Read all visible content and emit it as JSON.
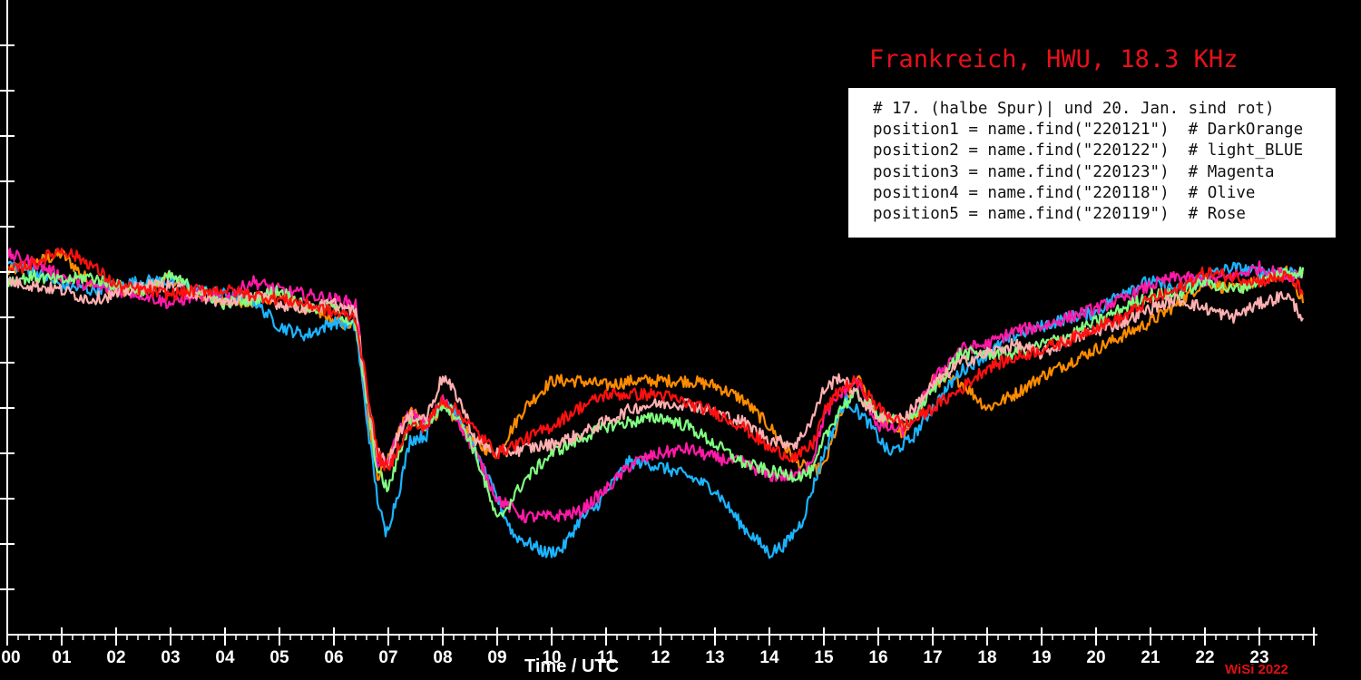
{
  "chart_data": {
    "type": "line",
    "title": "Frankreich, HWU, 18.3 KHz",
    "xlabel": "Time / UTC",
    "ylabel": "",
    "x_ticks": [
      "00",
      "01",
      "02",
      "03",
      "04",
      "05",
      "06",
      "07",
      "08",
      "09",
      "10",
      "11",
      "12",
      "13",
      "14",
      "15",
      "16",
      "17",
      "18",
      "19",
      "20",
      "21",
      "22",
      "23"
    ],
    "xlim": [
      0,
      24
    ],
    "ylim": [
      0,
      14
    ],
    "grid": false,
    "legend_text": [
      "# 17. (halbe Spur)| und 20. Jan. sind rot)",
      "position1 = name.find(\"220121\")  # DarkOrange",
      "position2 = name.find(\"220122\")  # light_BLUE",
      "position3 = name.find(\"220123\")  # Magenta",
      "position4 = name.find(\"220118\")  # Olive",
      "position5 = name.find(\"220119\")  # Rose"
    ],
    "legend_placement": "top-right",
    "series": [
      {
        "color": "#ff8c00",
        "x": [
          0,
          0.5,
          1,
          1.5,
          2,
          2.5,
          3,
          3.5,
          4,
          4.5,
          5,
          5.5,
          6,
          6.4,
          6.6,
          6.8,
          7,
          7.2,
          7.4,
          7.7,
          8,
          8.3,
          8.6,
          9,
          9.5,
          10,
          10.5,
          11,
          11.5,
          12,
          12.5,
          13,
          13.5,
          14,
          14.5,
          14.8,
          15,
          15.3,
          15.6,
          16,
          16.5,
          17,
          17.5,
          18,
          18.5,
          19,
          19.5,
          20,
          20.5,
          21,
          21.5,
          22,
          22.5,
          23,
          23.5,
          23.8
        ],
        "y": [
          8.0,
          8.2,
          8.4,
          7.8,
          7.6,
          7.6,
          7.9,
          7.5,
          7.4,
          7.3,
          7.5,
          7.2,
          6.9,
          6.8,
          5.0,
          3.5,
          3.9,
          4.5,
          4.9,
          4.7,
          5.0,
          4.7,
          4.2,
          4.0,
          5.0,
          5.6,
          5.6,
          5.5,
          5.6,
          5.6,
          5.6,
          5.5,
          5.2,
          4.6,
          3.8,
          3.6,
          3.7,
          4.8,
          5.7,
          4.8,
          4.4,
          5.6,
          5.6,
          5.0,
          5.3,
          5.7,
          6.0,
          6.3,
          6.6,
          6.9,
          7.3,
          7.8,
          7.6,
          7.8,
          8.0,
          7.4
        ]
      },
      {
        "color": "#1cb4ff",
        "x": [
          0,
          0.5,
          1,
          1.5,
          2,
          2.5,
          3,
          3.5,
          4,
          4.5,
          5,
          5.5,
          6,
          6.4,
          6.6,
          6.8,
          6.95,
          7.2,
          7.4,
          7.7,
          8,
          8.3,
          8.6,
          9,
          9.3,
          9.6,
          9.9,
          10.2,
          10.5,
          10.8,
          11.1,
          11.4,
          11.7,
          12,
          12.5,
          13,
          13.5,
          14,
          14.3,
          14.6,
          15,
          15.4,
          15.8,
          16.2,
          16.6,
          17,
          17.5,
          18,
          18.5,
          19,
          19.5,
          20,
          20.5,
          21,
          21.5,
          22,
          22.5,
          23,
          23.5,
          23.8
        ],
        "y": [
          8.2,
          8.0,
          7.7,
          7.6,
          7.7,
          7.8,
          7.8,
          7.6,
          7.5,
          7.4,
          6.8,
          6.6,
          6.9,
          6.8,
          4.8,
          3.0,
          2.2,
          3.2,
          4.3,
          4.4,
          5.3,
          4.8,
          4.0,
          3.0,
          2.2,
          2.0,
          1.8,
          1.9,
          2.5,
          2.8,
          3.3,
          3.8,
          3.8,
          3.7,
          3.5,
          3.2,
          2.4,
          1.8,
          2.0,
          2.5,
          4.0,
          5.2,
          4.7,
          4.0,
          4.3,
          5.0,
          5.8,
          6.2,
          6.6,
          6.8,
          7.0,
          7.1,
          7.6,
          7.8,
          7.6,
          7.9,
          8.1,
          8.0,
          8.0,
          8.0
        ]
      },
      {
        "color": "#ff1aa8",
        "x": [
          0,
          0.5,
          1,
          1.5,
          2,
          2.5,
          3,
          3.5,
          4,
          4.5,
          5,
          5.5,
          6,
          6.4,
          6.6,
          6.8,
          7,
          7.2,
          7.4,
          7.7,
          8,
          8.3,
          8.6,
          9,
          9.5,
          10,
          10.5,
          11,
          11.5,
          12,
          12.5,
          13,
          13.5,
          14,
          14.5,
          14.8,
          15,
          15.3,
          15.6,
          16,
          16.5,
          17,
          17.5,
          18,
          18.5,
          19,
          19.5,
          20,
          20.5,
          21,
          21.5,
          22,
          22.5,
          23,
          23.5,
          23.8
        ],
        "y": [
          8.4,
          8.2,
          7.9,
          7.7,
          7.6,
          7.5,
          7.3,
          7.5,
          7.4,
          7.8,
          7.6,
          7.5,
          7.4,
          7.3,
          5.2,
          3.8,
          3.8,
          4.5,
          4.9,
          4.6,
          5.2,
          4.7,
          4.0,
          3.0,
          2.6,
          2.6,
          2.7,
          3.2,
          3.8,
          4.0,
          4.1,
          3.9,
          3.8,
          3.5,
          3.5,
          3.9,
          4.8,
          5.3,
          5.6,
          4.6,
          4.5,
          5.6,
          6.3,
          6.4,
          6.7,
          6.8,
          7.0,
          7.2,
          7.4,
          7.7,
          7.9,
          7.8,
          7.9,
          8.1,
          7.9,
          8.0
        ]
      },
      {
        "color": "#80ff80",
        "x": [
          0,
          0.5,
          1,
          1.5,
          2,
          2.5,
          3,
          3.5,
          4,
          4.5,
          5,
          5.5,
          6,
          6.4,
          6.6,
          6.8,
          7,
          7.2,
          7.4,
          7.7,
          8,
          8.3,
          8.6,
          9,
          9.5,
          10,
          10.5,
          11,
          11.5,
          12,
          12.5,
          13,
          13.5,
          14,
          14.5,
          14.8,
          15,
          15.3,
          15.6,
          16,
          16.5,
          17,
          17.5,
          18,
          18.5,
          19,
          19.5,
          20,
          20.5,
          21,
          21.5,
          22,
          22.5,
          23,
          23.5,
          23.8
        ],
        "y": [
          7.8,
          7.9,
          7.8,
          7.9,
          7.7,
          7.6,
          7.9,
          7.6,
          7.3,
          7.4,
          7.6,
          7.2,
          7.2,
          6.8,
          5.2,
          3.6,
          3.2,
          4.0,
          4.7,
          4.6,
          5.1,
          4.8,
          4.0,
          2.5,
          3.4,
          4.0,
          4.3,
          4.6,
          4.7,
          4.8,
          4.6,
          4.2,
          3.8,
          3.6,
          3.5,
          3.6,
          4.3,
          5.0,
          5.3,
          4.9,
          4.6,
          5.4,
          6.2,
          6.2,
          6.2,
          6.4,
          6.6,
          6.9,
          7.2,
          7.5,
          7.5,
          7.8,
          7.6,
          7.8,
          8.0,
          8.0
        ]
      },
      {
        "color": "#ffb0b0",
        "x": [
          0,
          0.5,
          1,
          1.5,
          2,
          2.5,
          3,
          3.5,
          4,
          4.5,
          5,
          5.5,
          6,
          6.4,
          6.6,
          6.8,
          7,
          7.2,
          7.4,
          7.7,
          8,
          8.3,
          8.6,
          9,
          9.5,
          10,
          10.5,
          11,
          11.5,
          12,
          12.5,
          13,
          13.5,
          14,
          14.5,
          14.8,
          15,
          15.3,
          15.6,
          16,
          16.5,
          17,
          17.5,
          18,
          18.5,
          19,
          19.5,
          20,
          20.5,
          21,
          21.5,
          22,
          22.5,
          23,
          23.5,
          23.8
        ],
        "y": [
          7.8,
          7.7,
          7.6,
          7.4,
          7.5,
          7.7,
          7.7,
          7.5,
          7.3,
          7.5,
          7.3,
          7.2,
          7.3,
          7.1,
          5.4,
          4.0,
          3.8,
          4.5,
          4.8,
          4.8,
          5.7,
          5.2,
          4.3,
          4.0,
          4.1,
          4.2,
          4.4,
          4.7,
          5.0,
          5.1,
          5.1,
          4.9,
          4.7,
          4.3,
          4.2,
          4.8,
          5.4,
          5.7,
          5.3,
          4.8,
          4.8,
          5.5,
          6.0,
          6.2,
          6.4,
          6.2,
          6.5,
          6.7,
          6.9,
          7.2,
          7.4,
          7.2,
          7.0,
          7.3,
          7.5,
          7.0
        ]
      },
      {
        "color": "#ff1010",
        "x": [
          0,
          0.5,
          1,
          1.5,
          2,
          2.5,
          3,
          3.5,
          4,
          4.5,
          5,
          5.5,
          6,
          6.4,
          6.6,
          6.8,
          7,
          7.2,
          7.4,
          7.7,
          8,
          8.3,
          8.6,
          9,
          9.5,
          10,
          10.5,
          11,
          11.5,
          12,
          12.5,
          13,
          13.5,
          14,
          14.5,
          14.8,
          15,
          15.3,
          15.6,
          16,
          16.5,
          17,
          17.5,
          18,
          18.5,
          19,
          19.5,
          20,
          20.5,
          21,
          21.5,
          22,
          22.5,
          23,
          23.5,
          23.8
        ],
        "y": [
          8.0,
          8.2,
          8.5,
          8.2,
          7.7,
          7.6,
          7.5,
          7.6,
          7.6,
          7.5,
          7.4,
          7.3,
          7.1,
          7.0,
          5.5,
          4.0,
          3.6,
          4.2,
          4.6,
          4.6,
          5.2,
          4.9,
          4.5,
          4.0,
          4.3,
          4.6,
          5.0,
          5.3,
          5.3,
          5.3,
          5.1,
          4.9,
          4.6,
          4.1,
          3.9,
          4.2,
          4.9,
          5.4,
          5.6,
          5.0,
          4.6,
          5.0,
          5.4,
          5.9,
          6.1,
          6.3,
          6.5,
          6.8,
          7.0,
          7.4,
          7.6,
          8.0,
          7.9,
          7.8,
          7.9,
          7.6
        ]
      }
    ]
  },
  "labels": {
    "credit": "WiSi 2022"
  }
}
